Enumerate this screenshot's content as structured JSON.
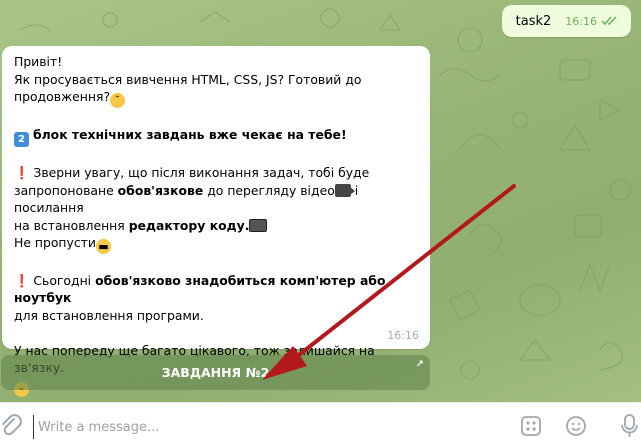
{
  "outgoing_message": {
    "text": "task2",
    "time": "16:16"
  },
  "incoming_message": {
    "greeting": "Привіт!",
    "line1": "Як просувається вивчення HTML, CSS, JS? Готовий до",
    "line2": "продовження?",
    "block_title": "блок технічних завдань вже чекає на тебе!",
    "badge_number": "2",
    "para1_a": " Зверни увагу, що після виконання задач, тобі буде",
    "para1_b_pre": "запропоноване ",
    "para1_b_bold": "обов'язкове",
    "para1_b_post": " до перегляду відео",
    "para1_b_tail": " і посилання",
    "para1_c_pre": "на встановлення ",
    "para1_c_bold": "редактору коду.",
    "para1_d": "Не пропусти",
    "para2_pre": " Сьогодні ",
    "para2_bold": "обов'язково знадобиться комп'ютер або ноутбук",
    "para2_b": "для встановлення програми.",
    "para3": "У нас попереду ще багато цікавого, тож залишайся на зв'язку.",
    "time": "16:16"
  },
  "inline_button": {
    "label": "ЗАВДАННЯ №2",
    "corner_glyph": "↗"
  },
  "composer": {
    "placeholder": "Write a message..."
  },
  "colors": {
    "chat_background": "#9cb87a",
    "outgoing_bubble": "#effdde",
    "read_ticks": "#6cb05f",
    "annotation_arrow": "#b3181c"
  },
  "icons": {
    "attach": "paperclip-icon",
    "commands": "bot-commands-icon",
    "emoji": "smile-icon",
    "mic": "microphone-icon",
    "read": "double-check-icon"
  }
}
